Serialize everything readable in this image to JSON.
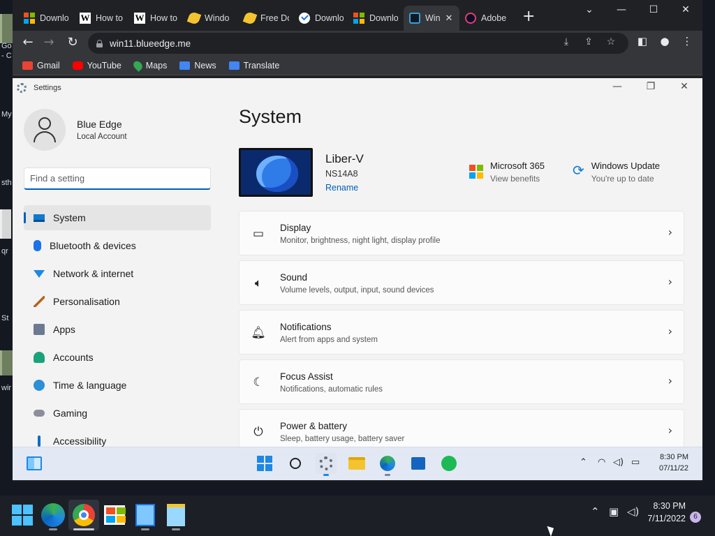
{
  "browser": {
    "tabs": [
      {
        "title": "Downlo",
        "icon": "microsoft-icon"
      },
      {
        "title": "How to",
        "icon": "w-icon"
      },
      {
        "title": "How to",
        "icon": "w-icon"
      },
      {
        "title": "Windo",
        "icon": "leaf-icon"
      },
      {
        "title": "Free Do",
        "icon": "leaf-icon"
      },
      {
        "title": "Downlo",
        "icon": "check-icon"
      },
      {
        "title": "Downlo",
        "icon": "microsoft-icon"
      },
      {
        "title": "Win",
        "icon": "win11-icon",
        "active": true
      },
      {
        "title": "Adobe",
        "icon": "adobe-icon"
      }
    ],
    "url": "win11.blueedge.me",
    "bookmarks": [
      {
        "label": "Gmail",
        "color": "#ea4335"
      },
      {
        "label": "YouTube",
        "color": "#ff0000"
      },
      {
        "label": "Maps",
        "color": "#34a853"
      },
      {
        "label": "News",
        "color": "#4285f4"
      },
      {
        "label": "Translate",
        "color": "#4285f4"
      }
    ]
  },
  "desktop": {
    "fragments": [
      "Go",
      "- C",
      "My",
      "sth",
      "qr",
      "St",
      "wir"
    ]
  },
  "settings": {
    "window_title": "Settings",
    "profile": {
      "name": "Blue Edge",
      "account": "Local Account"
    },
    "search_placeholder": "Find a setting",
    "nav": [
      {
        "label": "System",
        "icon": "display-icon",
        "selected": true
      },
      {
        "label": "Bluetooth & devices",
        "icon": "bluetooth-icon"
      },
      {
        "label": "Network & internet",
        "icon": "wifi-icon"
      },
      {
        "label": "Personalisation",
        "icon": "brush-icon"
      },
      {
        "label": "Apps",
        "icon": "apps-icon"
      },
      {
        "label": "Accounts",
        "icon": "person-icon"
      },
      {
        "label": "Time & language",
        "icon": "globe-icon"
      },
      {
        "label": "Gaming",
        "icon": "gamepad-icon"
      },
      {
        "label": "Accessibility",
        "icon": "accessibility-icon"
      }
    ],
    "page_title": "System",
    "device": {
      "name": "Liber-V",
      "model": "NS14A8",
      "rename": "Rename"
    },
    "quick_links": [
      {
        "title": "Microsoft 365",
        "sub": "View benefits",
        "icon": "microsoft-icon"
      },
      {
        "title": "Windows Update",
        "sub": "You're up to date",
        "icon": "update-icon"
      }
    ],
    "cards": [
      {
        "title": "Display",
        "sub": "Monitor, brightness, night light, display profile",
        "icon": "monitor-icon"
      },
      {
        "title": "Sound",
        "sub": "Volume levels, output, input, sound devices",
        "icon": "speaker-icon"
      },
      {
        "title": "Notifications",
        "sub": "Alert from apps and system",
        "icon": "bell-icon"
      },
      {
        "title": "Focus Assist",
        "sub": "Notifications, automatic rules",
        "icon": "moon-icon"
      },
      {
        "title": "Power & battery",
        "sub": "Sleep, battery usage, battery saver",
        "icon": "power-icon"
      }
    ]
  },
  "inner_taskbar": {
    "time": "8:30 PM",
    "date": "07/11/22"
  },
  "outer_taskbar": {
    "time": "8:30 PM",
    "date": "7/11/2022",
    "notification_count": "6"
  },
  "colors": {
    "accent": "#005fb8",
    "chrome_dark": "#202124",
    "chrome_toolbar": "#35363a"
  }
}
